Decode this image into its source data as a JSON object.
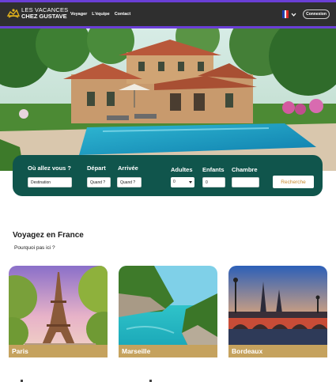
{
  "header": {
    "brand_line1": "LES VACANCES",
    "brand_line2": "CHEZ GUSTAVE",
    "nav": [
      "Voyager",
      "L'équipe",
      "Contact"
    ],
    "language_flag": "flag-france-icon",
    "login_label": "Connexion",
    "colors": {
      "bar": "#2f2f2f",
      "accent_border": "#6a3fd6",
      "logo": "#e3b31b"
    }
  },
  "hero": {
    "image": "villa-with-pool",
    "carousel_dots": 4
  },
  "search": {
    "destination_label": "Où allez vous ?",
    "destination_value": "Destination",
    "depart_label": "Départ",
    "depart_value": "Quand ?",
    "arrivee_label": "Arrivée",
    "arrivee_value": "Quand ?",
    "adultes_label": "Adultes",
    "adultes_value": "0",
    "enfants_label": "Enfants",
    "enfants_value": "0",
    "chambre_label": "Chambre",
    "chambre_value": "",
    "button_label": "Recherche",
    "colors": {
      "panel": "#10554c",
      "button_text": "#c88a2d"
    }
  },
  "section": {
    "title": "Voyagez en France",
    "subtitle": "Pourquoi pas ici ?"
  },
  "cards": [
    {
      "label": "Paris",
      "image": "eiffel-tower"
    },
    {
      "label": "Marseille",
      "image": "calanques"
    },
    {
      "label": "Bordeaux",
      "image": "pont-de-pierre"
    }
  ],
  "card_label_color": "#c5a25e"
}
